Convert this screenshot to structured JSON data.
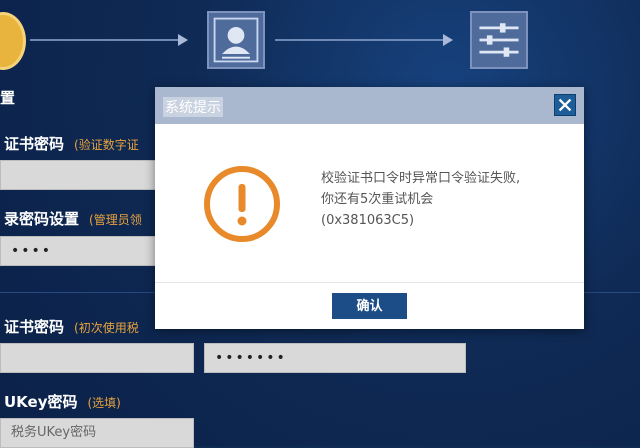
{
  "colors": {
    "background": "#0f2a55",
    "accent_orange": "#e8a33b",
    "warning_icon": "#e88a2a",
    "button_blue": "#1c4d86",
    "close_blue": "#1d5e9a"
  },
  "wizard": {
    "steps": [
      {
        "icon": "settings-circle-icon"
      },
      {
        "icon": "user-profile-icon"
      },
      {
        "icon": "sliders-icon"
      }
    ],
    "current_step_label": "置"
  },
  "form": {
    "sections": [
      {
        "label": "证书密码",
        "hint": "(验证数字证"
      },
      {
        "label": "录密码设置",
        "hint": "(管理员领"
      },
      {
        "label": "证书密码",
        "hint": "(初次使用税"
      },
      {
        "label": "UKey密码",
        "hint": "(选填)"
      }
    ],
    "fields": {
      "field1": "",
      "field2": "••••",
      "field3a": "",
      "field3b": "•••••••",
      "field4_placeholder": "税务UKey密码"
    }
  },
  "dialog": {
    "title": "系统提示",
    "icon": "warning-exclamation-icon",
    "message_line1": "校验证书口令时异常口令验证失败,",
    "message_line2": "你还有5次重试机会",
    "message_line3": "(0x381063C5)",
    "ok_label": "确认"
  }
}
